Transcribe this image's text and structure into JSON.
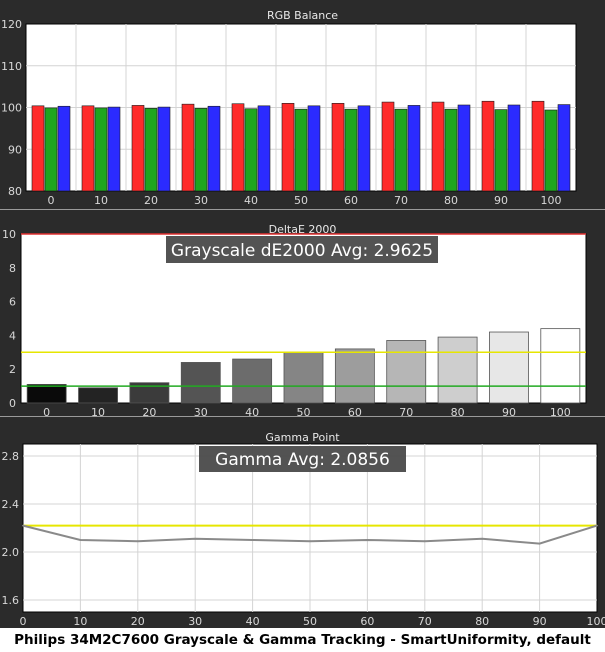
{
  "caption": "Philips 34M2C7600 Grayscale & Gamma Tracking - SmartUniformity, default",
  "colors": {
    "background": "#2b2b2b",
    "plot_background": "#ffffff",
    "grid": "#d4d4d4",
    "red": "#ff2b2b",
    "green": "#1fa51f",
    "blue": "#2b2bff",
    "reference_line": "#e6e600",
    "target_line_red": "#e03030",
    "target_line_green": "#22aa22",
    "gamma_line": "#8a8a8a"
  },
  "chart_data": [
    {
      "type": "bar",
      "title": "RGB Balance",
      "categories": [
        "0",
        "10",
        "20",
        "30",
        "40",
        "50",
        "60",
        "70",
        "80",
        "90",
        "100"
      ],
      "ylim": [
        80,
        120
      ],
      "yticks": [
        80,
        90,
        100,
        110,
        120
      ],
      "grid": true,
      "series": [
        {
          "color": "red",
          "values": [
            100.4,
            100.4,
            100.5,
            100.8,
            100.9,
            101.0,
            101.0,
            101.3,
            101.3,
            101.5,
            101.5
          ]
        },
        {
          "color": "green",
          "values": [
            99.9,
            99.9,
            99.8,
            99.8,
            99.7,
            99.6,
            99.6,
            99.6,
            99.6,
            99.5,
            99.4
          ]
        },
        {
          "color": "blue",
          "values": [
            100.3,
            100.1,
            100.1,
            100.3,
            100.4,
            100.4,
            100.4,
            100.5,
            100.6,
            100.6,
            100.7
          ]
        }
      ]
    },
    {
      "type": "bar",
      "title": "DeltaE 2000",
      "annotation": "Grayscale dE2000 Avg: 2.9625",
      "categories": [
        "0",
        "10",
        "20",
        "30",
        "40",
        "50",
        "60",
        "70",
        "80",
        "90",
        "100"
      ],
      "values": [
        1.1,
        0.9,
        1.2,
        2.4,
        2.6,
        3.0,
        3.2,
        3.7,
        3.9,
        4.2,
        4.4
      ],
      "ylim": [
        0,
        10
      ],
      "yticks": [
        0,
        2,
        4,
        6,
        8,
        10
      ],
      "reference_lines": [
        {
          "value": 10,
          "color": "target_line_red"
        },
        {
          "value": 3,
          "color": "reference_line"
        },
        {
          "value": 1,
          "color": "target_line_green"
        }
      ],
      "bar_fill": "grayscale by stimulus level"
    },
    {
      "type": "line",
      "title": "Gamma Point",
      "annotation": "Gamma Avg: 2.0856",
      "x": [
        0,
        10,
        20,
        30,
        40,
        50,
        60,
        70,
        80,
        90,
        100
      ],
      "y": [
        2.22,
        2.1,
        2.09,
        2.11,
        2.1,
        2.09,
        2.1,
        2.09,
        2.11,
        2.07,
        2.22
      ],
      "target": 2.22,
      "ylim": [
        1.5,
        2.9
      ],
      "yticks": [
        1.6,
        2.0,
        2.4,
        2.8
      ],
      "xlim": [
        0,
        100
      ],
      "xticks": [
        0,
        10,
        20,
        30,
        40,
        50,
        60,
        70,
        80,
        90,
        100
      ],
      "grid": true
    }
  ]
}
